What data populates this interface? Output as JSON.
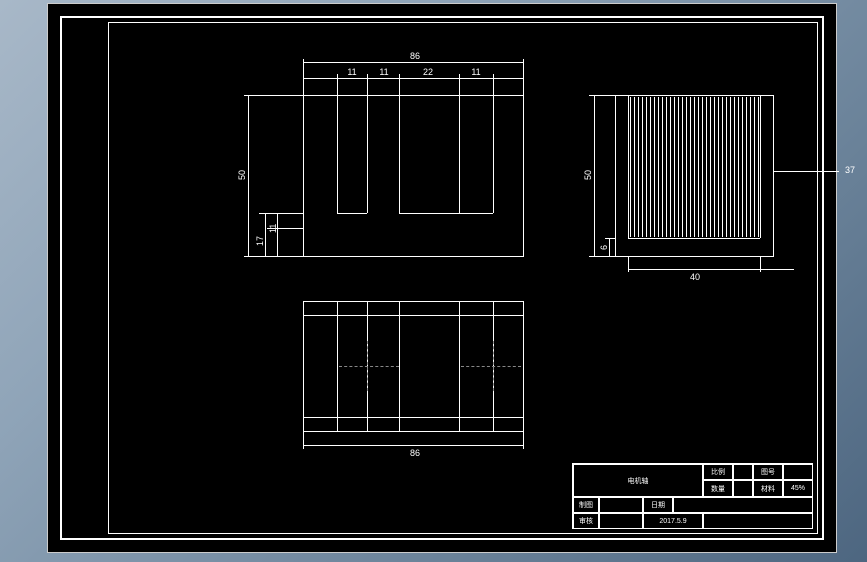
{
  "dimensions": {
    "overall_width": "86",
    "seg1": "11",
    "seg2": "11",
    "seg3": "22",
    "seg4": "11",
    "height_main": "50",
    "height_sub1": "17",
    "height_sub2": "11",
    "bottom_width": "86",
    "right_height": "50",
    "right_small": "6",
    "right_width": "40",
    "right_ext": "37"
  },
  "title_block": {
    "part_name": "电机轴",
    "col_ratio": "比例",
    "col_drawing_no": "图号",
    "col_count": "数量",
    "col_material": "材料",
    "material_value": "45%",
    "row_drawn": "制图",
    "row_date": "日期",
    "row_checked": "审核",
    "date_value": "2017.5.9"
  }
}
